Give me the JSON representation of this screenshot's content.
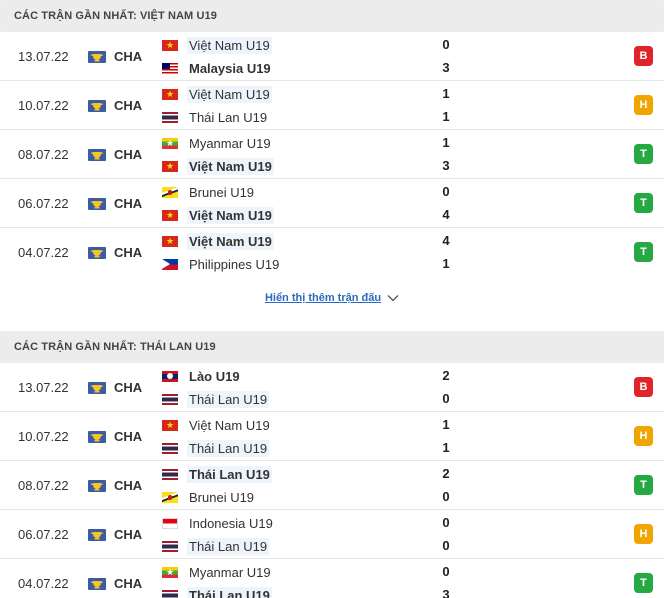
{
  "sections": [
    {
      "title": "CÁC TRẬN GẦN NHẤT: VIỆT NAM U19",
      "show_more": "Hiển thị thêm trận đấu",
      "matches": [
        {
          "date": "13.07.22",
          "league": "CHA",
          "home": {
            "name": "Việt Nam U19",
            "flag": "vn",
            "highlight": true,
            "bold": false
          },
          "away": {
            "name": "Malaysia U19",
            "flag": "my",
            "highlight": false,
            "bold": true
          },
          "home_score": "0",
          "away_score": "3",
          "result": "B"
        },
        {
          "date": "10.07.22",
          "league": "CHA",
          "home": {
            "name": "Việt Nam U19",
            "flag": "vn",
            "highlight": true,
            "bold": false
          },
          "away": {
            "name": "Thái Lan U19",
            "flag": "th",
            "highlight": false,
            "bold": false
          },
          "home_score": "1",
          "away_score": "1",
          "result": "H"
        },
        {
          "date": "08.07.22",
          "league": "CHA",
          "home": {
            "name": "Myanmar U19",
            "flag": "mm",
            "highlight": false,
            "bold": false
          },
          "away": {
            "name": "Việt Nam U19",
            "flag": "vn",
            "highlight": true,
            "bold": true
          },
          "home_score": "1",
          "away_score": "3",
          "result": "T"
        },
        {
          "date": "06.07.22",
          "league": "CHA",
          "home": {
            "name": "Brunei U19",
            "flag": "bn",
            "highlight": false,
            "bold": false
          },
          "away": {
            "name": "Việt Nam U19",
            "flag": "vn",
            "highlight": true,
            "bold": true
          },
          "home_score": "0",
          "away_score": "4",
          "result": "T"
        },
        {
          "date": "04.07.22",
          "league": "CHA",
          "home": {
            "name": "Việt Nam U19",
            "flag": "vn",
            "highlight": true,
            "bold": true
          },
          "away": {
            "name": "Philippines U19",
            "flag": "ph",
            "highlight": false,
            "bold": false
          },
          "home_score": "4",
          "away_score": "1",
          "result": "T"
        }
      ]
    },
    {
      "title": "CÁC TRẬN GẦN NHẤT: THÁI LAN U19",
      "matches": [
        {
          "date": "13.07.22",
          "league": "CHA",
          "home": {
            "name": "Lào U19",
            "flag": "la",
            "highlight": false,
            "bold": true
          },
          "away": {
            "name": "Thái Lan U19",
            "flag": "th",
            "highlight": true,
            "bold": false
          },
          "home_score": "2",
          "away_score": "0",
          "result": "B"
        },
        {
          "date": "10.07.22",
          "league": "CHA",
          "home": {
            "name": "Việt Nam U19",
            "flag": "vn",
            "highlight": false,
            "bold": false
          },
          "away": {
            "name": "Thái Lan U19",
            "flag": "th",
            "highlight": true,
            "bold": false
          },
          "home_score": "1",
          "away_score": "1",
          "result": "H"
        },
        {
          "date": "08.07.22",
          "league": "CHA",
          "home": {
            "name": "Thái Lan U19",
            "flag": "th",
            "highlight": true,
            "bold": true
          },
          "away": {
            "name": "Brunei U19",
            "flag": "bn",
            "highlight": false,
            "bold": false
          },
          "home_score": "2",
          "away_score": "0",
          "result": "T"
        },
        {
          "date": "06.07.22",
          "league": "CHA",
          "home": {
            "name": "Indonesia U19",
            "flag": "id",
            "highlight": false,
            "bold": false
          },
          "away": {
            "name": "Thái Lan U19",
            "flag": "th",
            "highlight": true,
            "bold": false
          },
          "home_score": "0",
          "away_score": "0",
          "result": "H"
        },
        {
          "date": "04.07.22",
          "league": "CHA",
          "home": {
            "name": "Myanmar U19",
            "flag": "mm",
            "highlight": false,
            "bold": false
          },
          "away": {
            "name": "Thái Lan U19",
            "flag": "th",
            "highlight": true,
            "bold": true
          },
          "home_score": "0",
          "away_score": "3",
          "result": "T"
        }
      ]
    }
  ],
  "colors": {
    "loss": "#e0242a",
    "draw": "#f0a500",
    "win": "#26a842",
    "link": "#2a6bbf"
  },
  "icons": {
    "league": "league-trophy-icon",
    "expand": "chevron-down-icon"
  }
}
